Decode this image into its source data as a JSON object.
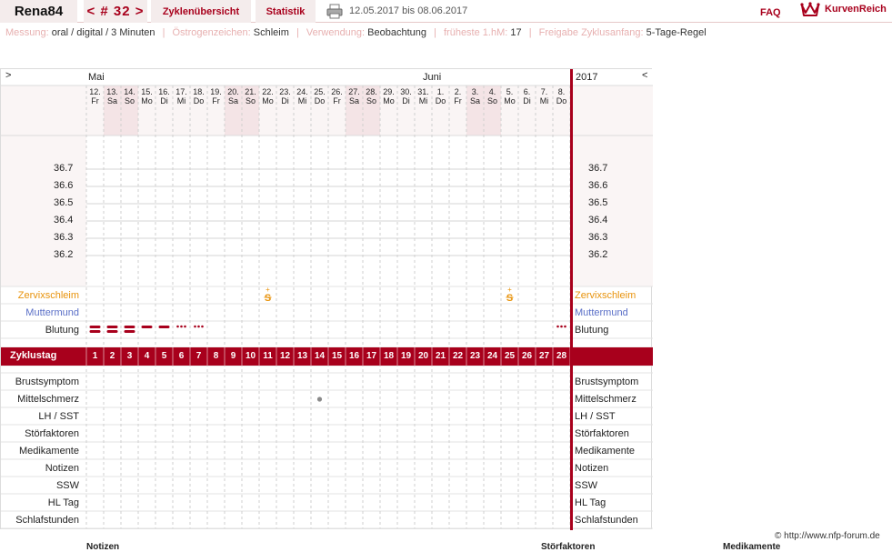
{
  "header": {
    "user": "Rena84",
    "cycle": "< # 32 >",
    "tab_overview": "Zyklenübersicht",
    "tab_stats": "Statistik",
    "date_range": "12.05.2017 bis 08.06.2017",
    "faq": "FAQ",
    "brand": "KurvenReich"
  },
  "info": [
    {
      "label": "Messung:",
      "value": "oral / digital / 3 Minuten"
    },
    {
      "label": "Östrogenzeichen:",
      "value": "Schleim"
    },
    {
      "label": "Verwendung:",
      "value": "Beobachtung"
    },
    {
      "label": "früheste 1.hM:",
      "value": "17"
    },
    {
      "label": "Freigabe Zyklusanfang:",
      "value": "5-Tage-Regel"
    }
  ],
  "chart": {
    "nav_prev": ">",
    "nav_next": "<",
    "month_start": "Mai",
    "month_mid": "Juni",
    "year": "2017",
    "dates": [
      "12.",
      "13.",
      "14.",
      "15.",
      "16.",
      "17.",
      "18.",
      "19.",
      "20.",
      "21.",
      "22.",
      "23.",
      "24.",
      "25.",
      "26.",
      "27.",
      "28.",
      "29.",
      "30.",
      "31.",
      "1.",
      "2.",
      "3.",
      "4.",
      "5.",
      "6.",
      "7.",
      "8."
    ],
    "weekdays": [
      "Fr",
      "Sa",
      "So",
      "Mo",
      "Di",
      "Mi",
      "Do",
      "Fr",
      "Sa",
      "So",
      "Mo",
      "Di",
      "Mi",
      "Do",
      "Fr",
      "Sa",
      "So",
      "Mo",
      "Di",
      "Mi",
      "Do",
      "Fr",
      "Sa",
      "So",
      "Mo",
      "Di",
      "Mi",
      "Do"
    ],
    "weekend_cols": [
      1,
      2,
      8,
      9,
      15,
      16,
      22,
      23
    ],
    "temp_ticks": [
      "36.7",
      "36.6",
      "36.5",
      "36.4",
      "36.3",
      "36.2"
    ],
    "rows_top": [
      "Zervixschleim",
      "Muttermund",
      "Blutung"
    ],
    "zyklustag_label": "Zyklustag",
    "cycle_days": [
      "1",
      "2",
      "3",
      "4",
      "5",
      "6",
      "7",
      "8",
      "9",
      "10",
      "11",
      "12",
      "13",
      "14",
      "15",
      "16",
      "17",
      "18",
      "19",
      "20",
      "21",
      "22",
      "23",
      "24",
      "25",
      "26",
      "27",
      "28"
    ],
    "rows_bottom": [
      "Brustsymptom",
      "Mittelschmerz",
      "LH / SST",
      "Störfaktoren",
      "Medikamente",
      "Notizen",
      "SSW",
      "HL Tag",
      "Schlafstunden"
    ],
    "mucus_marks": [
      {
        "day": 11,
        "symbol": "S+"
      },
      {
        "day": 25,
        "symbol": "S+"
      }
    ],
    "bleeding": [
      {
        "day": 1,
        "level": "heavy"
      },
      {
        "day": 2,
        "level": "heavy"
      },
      {
        "day": 3,
        "level": "heavy"
      },
      {
        "day": 4,
        "level": "medium"
      },
      {
        "day": 5,
        "level": "medium"
      },
      {
        "day": 6,
        "level": "spotting"
      },
      {
        "day": 7,
        "level": "spotting"
      },
      {
        "day": 28,
        "level": "spotting"
      }
    ],
    "mittelschmerz_days": [
      14
    ],
    "colors": {
      "accent": "#a8001c",
      "mucus": "#e8930c",
      "muttermund": "#5a6fc7",
      "weekend": "#f4e4e6",
      "grid": "#cfcfcf"
    }
  },
  "footer": "© http://www.nfp-forum.de",
  "bottom_labels": [
    "Notizen",
    "Störfaktoren",
    "Medikamente"
  ]
}
